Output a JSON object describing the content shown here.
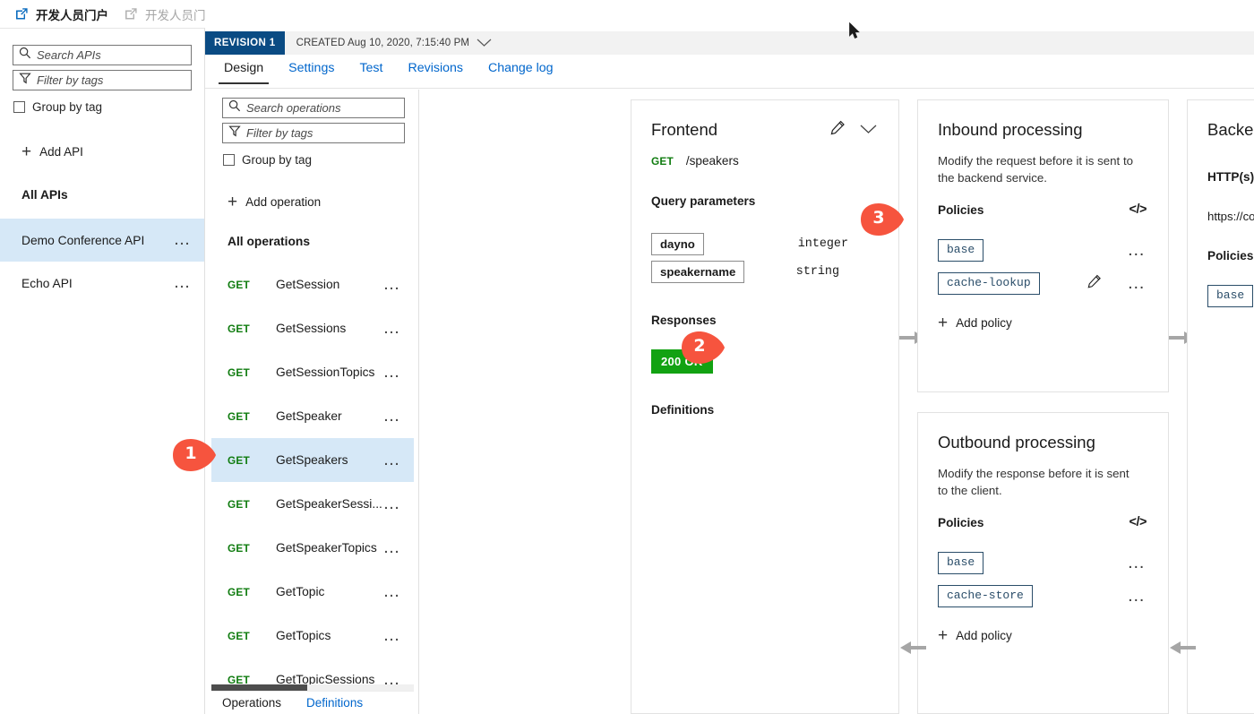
{
  "commandbar": {
    "links": [
      {
        "label": "开发人员门户",
        "icon": "external-link-icon",
        "state": "enabled"
      },
      {
        "label": "开发人员门户(旧版)",
        "icon": "external-link-icon",
        "state": "disabled"
      }
    ]
  },
  "apis_panel": {
    "search": {
      "placeholder": "Search APIs",
      "value": "",
      "icon": "search-icon"
    },
    "filter": {
      "placeholder": "Filter by tags",
      "value": "",
      "icon": "filter-icon"
    },
    "group_by_tag": {
      "label": "Group by tag",
      "checked": false
    },
    "add_api": {
      "label": "Add API",
      "icon": "plus-icon"
    },
    "section_title": "All APIs",
    "items": [
      {
        "label": "Demo Conference API",
        "selected": true,
        "menu": "…"
      },
      {
        "label": "Echo API",
        "selected": false,
        "menu": "…"
      }
    ]
  },
  "revision_bar": {
    "badge": "REVISION 1",
    "meta": "CREATED Aug 10, 2020, 7:15:40 PM",
    "chevron": "chevron-down-icon"
  },
  "tabs": [
    {
      "label": "Design",
      "active": true
    },
    {
      "label": "Settings",
      "active": false
    },
    {
      "label": "Test",
      "active": false
    },
    {
      "label": "Revisions",
      "active": false
    },
    {
      "label": "Change log",
      "active": false
    }
  ],
  "operations_panel": {
    "search": {
      "placeholder": "Search operations",
      "value": "",
      "icon": "search-icon"
    },
    "filter": {
      "placeholder": "Filter by tags",
      "value": "",
      "icon": "filter-icon"
    },
    "group_by_tag": {
      "label": "Group by tag",
      "checked": false
    },
    "add_operation": {
      "label": "Add operation",
      "icon": "plus-icon"
    },
    "section_title": "All operations",
    "items": [
      {
        "verb": "GET",
        "name": "GetSession",
        "selected": false,
        "menu": "…"
      },
      {
        "verb": "GET",
        "name": "GetSessions",
        "selected": false,
        "menu": "…"
      },
      {
        "verb": "GET",
        "name": "GetSessionTopics",
        "selected": false,
        "menu": "…"
      },
      {
        "verb": "GET",
        "name": "GetSpeaker",
        "selected": false,
        "menu": "…"
      },
      {
        "verb": "GET",
        "name": "GetSpeakers",
        "selected": true,
        "menu": "…"
      },
      {
        "verb": "GET",
        "name": "GetSpeakerSessi...",
        "selected": false,
        "menu": "…"
      },
      {
        "verb": "GET",
        "name": "GetSpeakerTopics",
        "selected": false,
        "menu": "…"
      },
      {
        "verb": "GET",
        "name": "GetTopic",
        "selected": false,
        "menu": "…"
      },
      {
        "verb": "GET",
        "name": "GetTopics",
        "selected": false,
        "menu": "…"
      },
      {
        "verb": "GET",
        "name": "GetTopicSessions",
        "selected": false,
        "menu": "…"
      }
    ],
    "footer_tabs": [
      {
        "label": "Operations",
        "active": true
      },
      {
        "label": "Definitions",
        "active": false
      }
    ]
  },
  "frontend_card": {
    "title": "Frontend",
    "edit_icon": "pencil-icon",
    "expand_icon": "chevron-down-icon",
    "verb": "GET",
    "path": "/speakers",
    "query_parameters_title": "Query parameters",
    "query_parameters": [
      {
        "name": "dayno",
        "type": "integer"
      },
      {
        "name": "speakername",
        "type": "string"
      }
    ],
    "responses_title": "Responses",
    "responses": [
      {
        "label": "200 OK",
        "color": "#12a212"
      }
    ],
    "definitions_title": "Definitions"
  },
  "inbound_card": {
    "title": "Inbound processing",
    "description": "Modify the request before it is sent to the backend service.",
    "policies_title": "Policies",
    "code_icon": "code-brackets-icon",
    "policies": [
      {
        "name": "base",
        "has_edit": false,
        "menu": "…"
      },
      {
        "name": "cache-lookup",
        "has_edit": true,
        "edit_icon": "pencil-icon",
        "menu": "…"
      }
    ],
    "add_policy": {
      "label": "Add policy",
      "icon": "plus-icon"
    }
  },
  "outbound_card": {
    "title": "Outbound processing",
    "description": "Modify the response before it is sent to the client.",
    "policies_title": "Policies",
    "code_icon": "code-brackets-icon",
    "policies": [
      {
        "name": "base",
        "has_edit": false,
        "menu": "…"
      },
      {
        "name": "cache-store",
        "has_edit": false,
        "menu": "…"
      }
    ],
    "add_policy": {
      "label": "Add policy",
      "icon": "plus-icon"
    }
  },
  "backend_card": {
    "title": "Backend",
    "endpoint_title": "HTTP(s) endpoint",
    "edit_icon": "pencil-icon",
    "endpoint_url": "https://conferenceapi.azurewebsites.net",
    "policies_title": "Policies",
    "code_icon": "code-brackets-icon",
    "policies": [
      {
        "name": "base",
        "menu": "…"
      }
    ]
  },
  "callouts": [
    {
      "number": "1",
      "target": "operations-list-item-getspeakers"
    },
    {
      "number": "2",
      "target": "inbound-add-policy"
    },
    {
      "number": "3",
      "target": "inbound-policies-code-editor"
    }
  ],
  "colors": {
    "accent_blue": "#0066cc",
    "revision_badge": "#0a4b83",
    "selection_blue": "#d6e8f7",
    "verb_green": "#107c10",
    "status_green": "#12a212",
    "callout_red": "#f6543e",
    "policy_border": "#2a4d69"
  }
}
